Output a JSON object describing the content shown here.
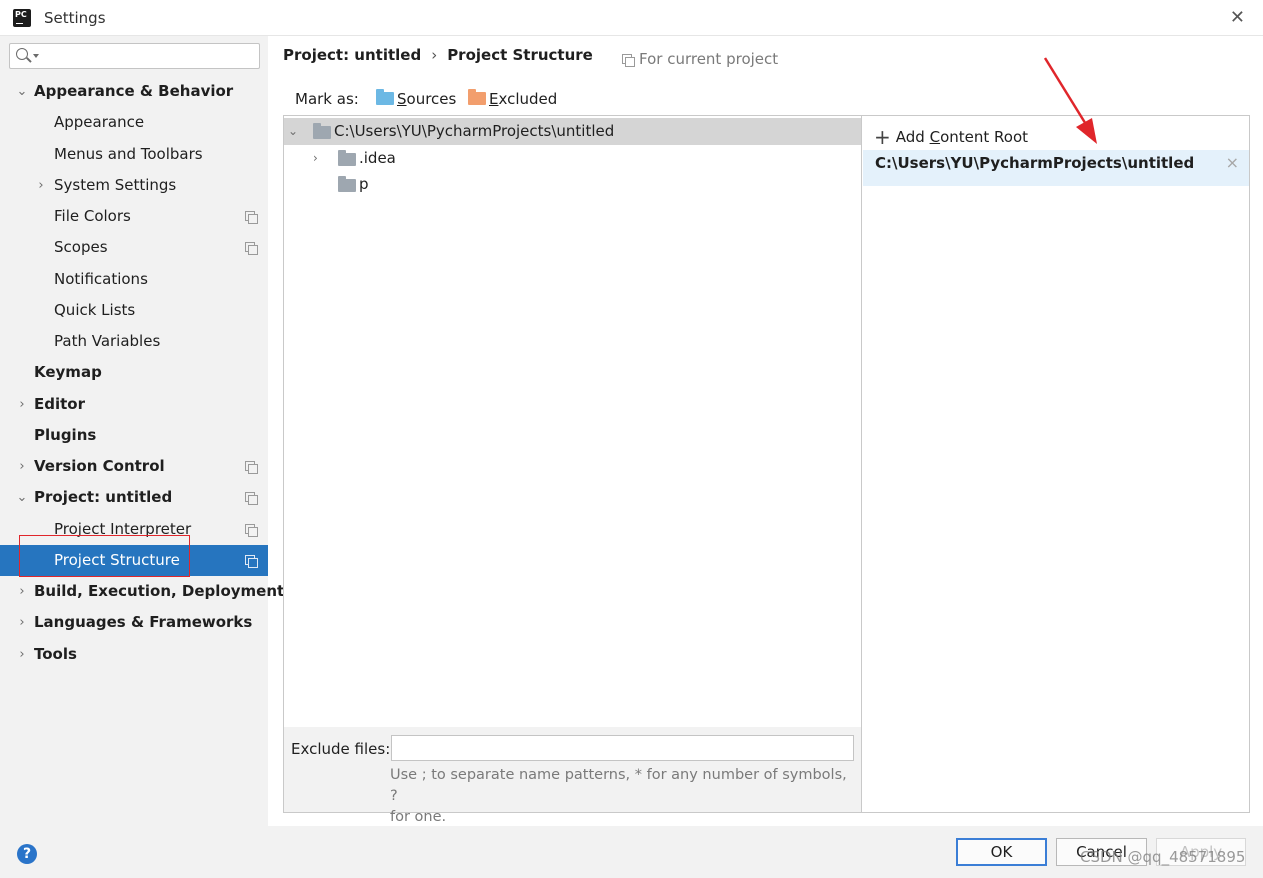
{
  "window": {
    "title": "Settings",
    "app_icon_text": "PC"
  },
  "search": {
    "placeholder": ""
  },
  "sidebar": {
    "items": [
      {
        "label": "Appearance & Behavior",
        "arrow": "⌄"
      },
      {
        "label": "Appearance"
      },
      {
        "label": "Menus and Toolbars"
      },
      {
        "label": "System Settings",
        "arrow": "›"
      },
      {
        "label": "File Colors"
      },
      {
        "label": "Scopes"
      },
      {
        "label": "Notifications"
      },
      {
        "label": "Quick Lists"
      },
      {
        "label": "Path Variables"
      },
      {
        "label": "Keymap"
      },
      {
        "label": "Editor",
        "arrow": "›"
      },
      {
        "label": "Plugins"
      },
      {
        "label": "Version Control",
        "arrow": "›"
      },
      {
        "label": "Project: untitled",
        "arrow": "⌄"
      },
      {
        "label": "Project Interpreter"
      },
      {
        "label": "Project Structure"
      },
      {
        "label": "Build, Execution, Deployment",
        "arrow": "›"
      },
      {
        "label": "Languages & Frameworks",
        "arrow": "›"
      },
      {
        "label": "Tools",
        "arrow": "›"
      }
    ]
  },
  "breadcrumb": {
    "parent": "Project: untitled",
    "separator": "›",
    "current": "Project Structure"
  },
  "scope_hint": "For current project",
  "mark_as": {
    "label": "Mark as:",
    "sources": {
      "mnemonic": "S",
      "rest": "ources",
      "color": "#6cb8e4"
    },
    "excluded": {
      "mnemonic": "E",
      "rest": "xcluded",
      "color": "#f29e6d"
    }
  },
  "file_tree": {
    "root": {
      "path": "C:\\Users\\YU\\PycharmProjects\\untitled",
      "arrow": "⌄"
    },
    "children": [
      {
        "name": ".idea",
        "arrow": "›"
      },
      {
        "name": "p"
      }
    ]
  },
  "exclude": {
    "label": "Exclude files:",
    "value": "",
    "hint_line1": "Use ; to separate name patterns, * for any number of symbols, ?",
    "hint_line2": "for one."
  },
  "content_root": {
    "add_icon": "+",
    "add_mnemonic_prefix": "Add ",
    "add_mnemonic": "C",
    "add_rest": "ontent Root",
    "path": "C:\\Users\\YU\\PycharmProjects\\untitled",
    "remove_icon": "×"
  },
  "buttons": {
    "help": "?",
    "ok": "OK",
    "cancel": "Cancel",
    "apply": "Apply"
  },
  "watermark": "CSDN @qq_48571895",
  "colors": {
    "selection": "#2675bf",
    "annotation": "#e0262b",
    "root_highlight": "#e4f1fb"
  }
}
